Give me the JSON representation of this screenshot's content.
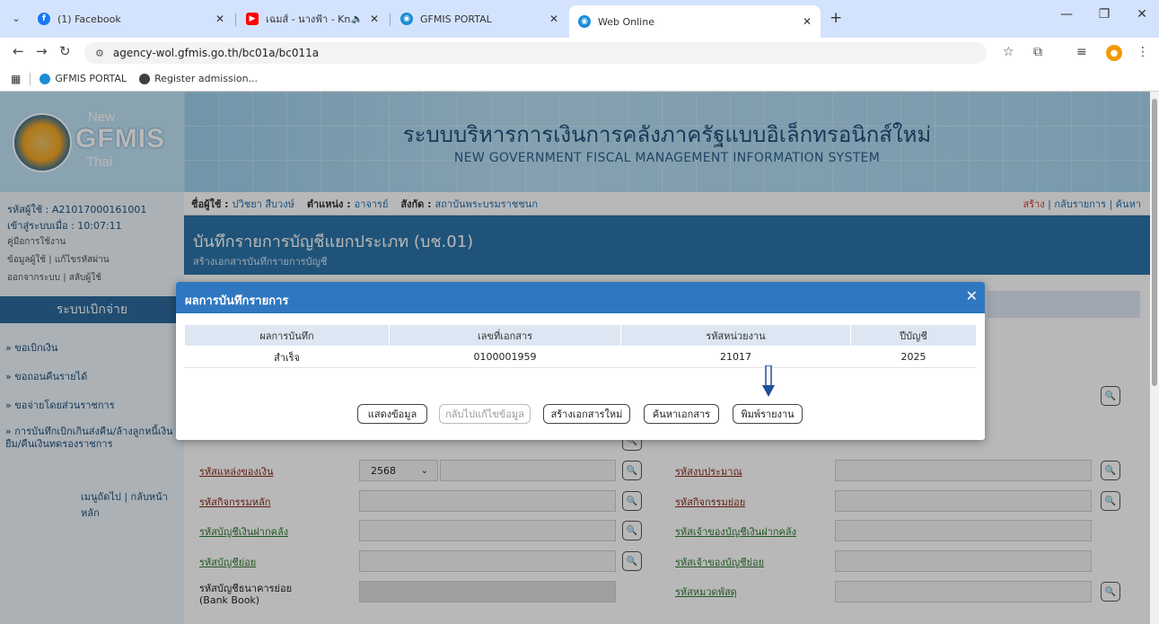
{
  "browser": {
    "tabs": [
      {
        "title": "(1) Facebook",
        "color": "#1877f2",
        "glyph": "f"
      },
      {
        "title": "เฉมส์ - นางฟ้า - Knock Out -",
        "color": "#ff0000",
        "glyph": "▶"
      },
      {
        "title": "GFMIS PORTAL",
        "color": "#1a8cd8",
        "glyph": "◉"
      },
      {
        "title": "Web Online",
        "color": "#1a8cd8",
        "glyph": "◉"
      }
    ],
    "url": "agency-wol.gfmis.go.th/bc01a/bc011a",
    "bookmarks": [
      {
        "label": "GFMIS PORTAL",
        "color": "#1a8cd8"
      },
      {
        "label": "Register admission...",
        "color": "#3c4043"
      }
    ],
    "profile_initial": "●"
  },
  "banner": {
    "logo_new": "New",
    "logo_gfmis": "GFMIS",
    "logo_thai": "Thai",
    "title_th": "ระบบบริหารการเงินการคลังภาครัฐแบบอิเล็กทรอนิกส์ใหม่",
    "title_en": "NEW GOVERNMENT FISCAL MANAGEMENT INFORMATION SYSTEM"
  },
  "sidebar": {
    "user_code": "รหัสผู้ใช้ : A21017000161001",
    "login_time": "เข้าสู่ระบบเมื่อ : 10:07:11",
    "manual": "คู่มือการใช้งาน",
    "profile_links": "ข้อมูลผู้ใช้ | แก้ไขรหัสผ่าน",
    "logout_links": "ออกจากระบบ | สลับผู้ใช้",
    "section_title": "ระบบเบิกจ่าย",
    "menu": [
      "» ขอเบิกเงิน",
      "» ขอถอนคืนรายได้",
      "» ขอจ่ายโดยส่วนราชการ",
      "» การบันทึกเบิกเกินส่งคืน/ล้างลูกหนี้เงินยืม/คืนเงินทดรองราชการ"
    ],
    "footer": "เมนูถัดไป | กลับหน้าหลัก"
  },
  "userbar": {
    "user_label": "ชื่อผู้ใช้ :",
    "user_value": "ปวิชยา สืบวงษ์",
    "position_label": "ตำแหน่ง :",
    "position_value": "อาจารย์",
    "org_label": "สังกัด :",
    "org_value": "สถาบันพระบรมราชชนก",
    "link_create": "สร้าง",
    "link_rest": "| กลับรายการ | ค้นหา"
  },
  "form": {
    "title": "บันทึกรายการบัญชีแยกประเภท (บช.01)",
    "subtitle": "สร้างเอกสารบันทึกรายการบัญชี",
    "row_a_label": "รหัสแหล่งของเงิน",
    "fiscal_year_value": "2568",
    "row_a_right": "รหัสงบประมาณ",
    "row_b_label": "รหัสกิจกรรมหลัก",
    "row_b_right": "รหัสกิจกรรมย่อย",
    "row_c_label": "รหัสบัญชีเงินฝากคลัง",
    "row_c_right": "รหัสเจ้าของบัญชีเงินฝากคลัง",
    "row_d_label": "รหัสบัญชีย่อย",
    "row_d_right": "รหัสเจ้าของบัญชีย่อย",
    "row_e_label": "รหัสบัญชีธนาคารย่อย",
    "row_e_label2": "(Bank Book)",
    "row_e_right": "รหัสหมวดพัสดุ"
  },
  "dialog": {
    "title": "ผลการบันทึกรายการ",
    "close": "✕",
    "columns": [
      "ผลการบันทึก",
      "เลขที่เอกสาร",
      "รหัสหน่วยงาน",
      "ปีบัญชี"
    ],
    "rows": [
      [
        "สำเร็จ",
        "0100001959",
        "21017",
        "2025"
      ]
    ],
    "buttons": {
      "show": "แสดงข้อมูล",
      "back_edit": "กลับไปแก้ไขข้อมูล",
      "create_new": "สร้างเอกสารใหม่",
      "search_doc": "ค้นหาเอกสาร",
      "print": "พิมพ์รายงาน"
    }
  }
}
